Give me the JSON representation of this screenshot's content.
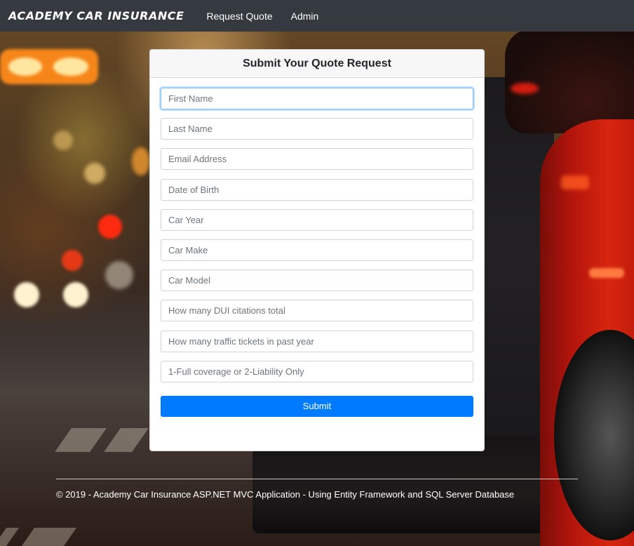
{
  "navbar": {
    "brand": "Academy Car Insurance",
    "links": [
      {
        "label": "Request Quote"
      },
      {
        "label": "Admin"
      }
    ]
  },
  "form": {
    "title": "Submit Your Quote Request",
    "fields": [
      {
        "placeholder": "First Name",
        "value": ""
      },
      {
        "placeholder": "Last Name",
        "value": ""
      },
      {
        "placeholder": "Email Address",
        "value": ""
      },
      {
        "placeholder": "Date of Birth",
        "value": ""
      },
      {
        "placeholder": "Car Year",
        "value": ""
      },
      {
        "placeholder": "Car Make",
        "value": ""
      },
      {
        "placeholder": "Car Model",
        "value": ""
      },
      {
        "placeholder": "How many DUI citations total",
        "value": ""
      },
      {
        "placeholder": "How many traffic tickets in past year",
        "value": ""
      },
      {
        "placeholder": "1-Full coverage or 2-Liability Only",
        "value": ""
      }
    ],
    "submit_label": "Submit"
  },
  "footer": {
    "text": "© 2019 - Academy Car Insurance ASP.NET MVC Application - Using Entity Framework and SQL Server Database"
  },
  "colors": {
    "navbar_bg": "#343a40",
    "primary": "#007bff",
    "card_header_bg": "#f7f7f7"
  }
}
